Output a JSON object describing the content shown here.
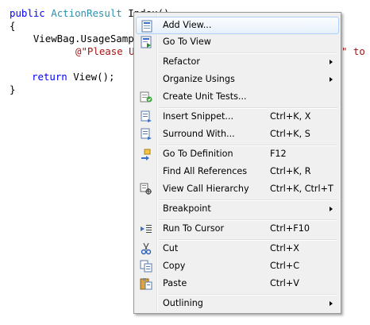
{
  "code": {
    "lines": [
      {
        "kw": "public",
        "sp1": " ",
        "type": "ActionResult",
        "rest": " Index()"
      },
      {
        "text": "{"
      },
      {
        "text": "    ViewBag.UsageSample"
      },
      {
        "str": "@\"Please Us"
      },
      {
        "text": ""
      },
      {
        "kw": "return",
        "rest": " View();"
      },
      {
        "text": "}"
      }
    ],
    "string_tail": "\" to"
  },
  "context_menu": {
    "items": [
      {
        "label": "Add View...",
        "shortcut": "",
        "submenu": false,
        "icon": "add-view-icon"
      },
      {
        "label": "Go To View",
        "shortcut": "",
        "submenu": false,
        "icon": "go-to-view-icon"
      },
      {
        "label": "Refactor",
        "shortcut": "",
        "submenu": true,
        "icon": ""
      },
      {
        "label": "Organize Usings",
        "shortcut": "",
        "submenu": true,
        "icon": ""
      },
      {
        "label": "Create Unit Tests...",
        "shortcut": "",
        "submenu": false,
        "icon": "create-unit-tests-icon"
      },
      {
        "label": "Insert Snippet...",
        "shortcut": "Ctrl+K, X",
        "submenu": false,
        "icon": "insert-snippet-icon"
      },
      {
        "label": "Surround With...",
        "shortcut": "Ctrl+K, S",
        "submenu": false,
        "icon": "surround-with-icon"
      },
      {
        "label": "Go To Definition",
        "shortcut": "F12",
        "submenu": false,
        "icon": "go-to-definition-icon"
      },
      {
        "label": "Find All References",
        "shortcut": "Ctrl+K, R",
        "submenu": false,
        "icon": ""
      },
      {
        "label": "View Call Hierarchy",
        "shortcut": "Ctrl+K, Ctrl+T",
        "submenu": false,
        "icon": "call-hierarchy-icon"
      },
      {
        "label": "Breakpoint",
        "shortcut": "",
        "submenu": true,
        "icon": ""
      },
      {
        "label": "Run To Cursor",
        "shortcut": "Ctrl+F10",
        "submenu": false,
        "icon": "run-to-cursor-icon"
      },
      {
        "label": "Cut",
        "shortcut": "Ctrl+X",
        "submenu": false,
        "icon": "cut-icon"
      },
      {
        "label": "Copy",
        "shortcut": "Ctrl+C",
        "submenu": false,
        "icon": "copy-icon"
      },
      {
        "label": "Paste",
        "shortcut": "Ctrl+V",
        "submenu": false,
        "icon": "paste-icon"
      },
      {
        "label": "Outlining",
        "shortcut": "",
        "submenu": true,
        "icon": ""
      }
    ]
  },
  "colors": {
    "keyword": "#0000ff",
    "type": "#2b91af",
    "string": "#a31515",
    "menu_bg": "#f0f0f0",
    "highlight_border": "#aecff7"
  }
}
